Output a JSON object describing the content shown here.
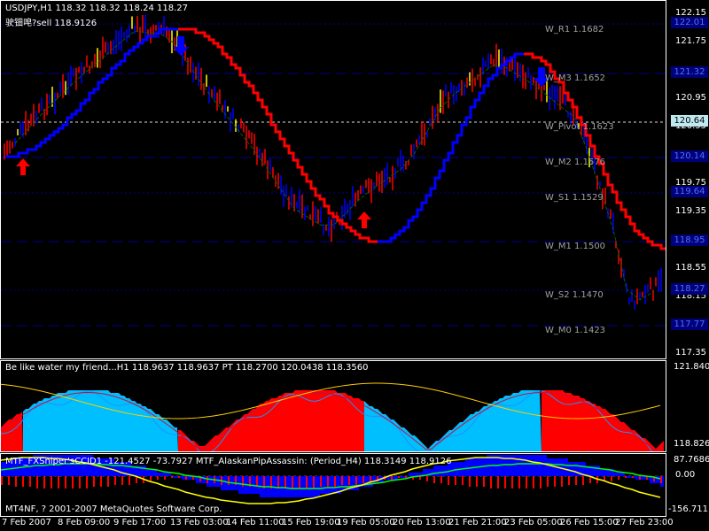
{
  "main": {
    "title": "USDJPY,H1  118.32 118.32 118.24 118.27",
    "signal": "驶钿唣?sell 118.9126",
    "levels": [
      {
        "label": "W_R1 1.1682",
        "box": "122.01"
      },
      {
        "label": "W_M3 1.1652",
        "box": "121.32"
      },
      {
        "label": "W_Pivot 1.1623",
        "box": "120.14"
      },
      {
        "label": "W_M2 1.1576",
        "box": "119.64"
      },
      {
        "label": "W_S1 1.1529",
        "box": "118.95"
      },
      {
        "label": "W_M1 1.1500",
        "box": "118.27"
      },
      {
        "label": "W_S2 1.1470",
        "box": "117.77"
      },
      {
        "label": "W_M0 1.1423",
        "box": ""
      }
    ],
    "current_price": "120.64",
    "axis": [
      "122.15",
      "121.75",
      "120.95",
      "120.55",
      "119.75",
      "119.35",
      "118.55",
      "118.15",
      "117.35"
    ]
  },
  "ind1": {
    "title": "Be like water my friend...H1   118.9637 118.9637  PT 118.2700 120.0438 118.3560",
    "max": "121.8406",
    "min": "118.8267"
  },
  "ind2": {
    "title": "MTF_FXSniper'sCCID1   -121.4527 -73.7927  MTF_AlaskanPipAssassin: (Period_H4) 118.3149 118.9126",
    "max": "87.7686",
    "zero": "0.00",
    "min": "-156.711",
    "copyright": "MT4NF, ? 2001-2007 MetaQuotes Software Corp."
  },
  "time_axis": [
    "7 Feb 2007",
    "8 Feb 09:00",
    "9 Feb 17:00",
    "13 Feb 03:00",
    "14 Feb 11:00",
    "15 Feb 19:00",
    "19 Feb 05:00",
    "20 Feb 13:00",
    "21 Feb 21:00",
    "23 Feb 05:00",
    "26 Feb 15:00",
    "27 Feb 23:00"
  ],
  "colors": {
    "up": "#0000ff",
    "down": "#ff0000",
    "cyan": "#00bfff",
    "level": "#000090"
  }
}
